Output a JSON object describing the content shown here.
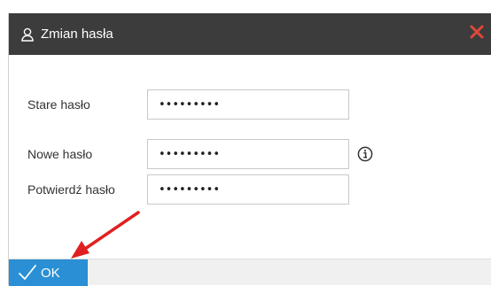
{
  "dialog": {
    "title": "Zmian hasła",
    "title_icon": "user-icon",
    "close_icon": "close-icon"
  },
  "form": {
    "old_password_label": "Stare hasło",
    "old_password_value": "•••••••••",
    "new_password_label": "Nowe hasło",
    "new_password_value": "•••••••••",
    "confirm_password_label": "Potwierdź hasło",
    "confirm_password_value": "•••••••••",
    "info_icon": "info-icon"
  },
  "footer": {
    "ok_label": "OK",
    "ok_icon": "checkmark-icon"
  },
  "colors": {
    "titlebar": "#3c3c3c",
    "close": "#e0473a",
    "ok_button": "#2a8fd4",
    "annotation_arrow": "#e02020"
  }
}
